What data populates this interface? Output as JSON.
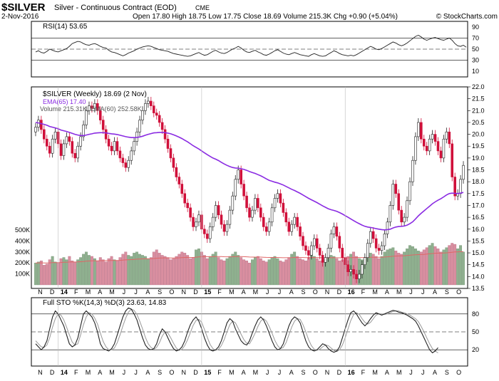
{
  "header": {
    "symbol": "$SILVER",
    "description": "Silver - Continuous Contract (EOD)",
    "exchange": "CME",
    "date": "2-Nov-2016",
    "quote_line": "Open 17.80  High 18.75  Low 17.75  Close 18.69  Volume 215.3K  Chg +0.90 (+5.04%)",
    "copyright": "© StockCharts.com"
  },
  "colors": {
    "up": "#222222",
    "down": "#d0103a",
    "ema": "#8a2be2",
    "volume_up": "#8fb08f",
    "volume_down": "#d98fa0",
    "volume_ema": "#e06666",
    "indicator": "#222222",
    "signal": "#999999"
  },
  "x_ticks": [
    "N",
    "D",
    "14",
    "F",
    "M",
    "A",
    "M",
    "J",
    "J",
    "A",
    "S",
    "O",
    "N",
    "D",
    "15",
    "F",
    "M",
    "A",
    "M",
    "J",
    "J",
    "A",
    "S",
    "O",
    "N",
    "D",
    "16",
    "F",
    "M",
    "A",
    "M",
    "J",
    "J",
    "A",
    "S",
    "O"
  ],
  "rsi": {
    "legend": "RSI(14) 53.65",
    "ticks": [
      "90",
      "70",
      "50",
      "30",
      "10"
    ],
    "bands": [
      70,
      30
    ],
    "midline": 50
  },
  "price": {
    "legend_main": "$SILVER (Weekly) 18.69 (2 Nov)",
    "legend_ema": "EMA(65) 17.40",
    "legend_volume": "Volume 215.31K, EMA(60) 252.58K",
    "ticks": [
      "22.0",
      "21.5",
      "21.0",
      "20.5",
      "20.0",
      "19.5",
      "19.0",
      "18.5",
      "18.0",
      "17.5",
      "17.0",
      "16.5",
      "16.0",
      "15.5",
      "15.0",
      "14.5",
      "14.0",
      "13.5"
    ],
    "volume_ticks": [
      "500K",
      "400K",
      "300K",
      "200K",
      "100K"
    ]
  },
  "sto": {
    "legend": "Full STO %K(14,3) %D(3) 23.63, 14.83",
    "ticks": [
      "80",
      "50",
      "20"
    ],
    "bands": [
      80,
      20
    ],
    "midline": 50
  },
  "chart_data": {
    "type": "candlestick",
    "title": "$SILVER Silver - Continuous Contract (EOD) CME",
    "period": "Weekly",
    "ylim": [
      13.5,
      22.0
    ],
    "last_close": 18.69,
    "ema65_last": 17.4,
    "closes": [
      20.3,
      20.6,
      20.2,
      19.8,
      19.5,
      19.2,
      19.8,
      20.1,
      19.6,
      19.1,
      19.6,
      19.9,
      19.7,
      19.2,
      19.0,
      19.5,
      19.9,
      20.4,
      21.0,
      21.2,
      21.1,
      21.3,
      21.0,
      20.6,
      20.2,
      19.8,
      19.5,
      19.3,
      19.7,
      19.3,
      19.0,
      18.8,
      18.6,
      18.9,
      19.3,
      19.7,
      20.1,
      20.6,
      21.0,
      21.3,
      21.4,
      21.2,
      20.9,
      20.8,
      20.5,
      20.2,
      19.8,
      19.4,
      19.0,
      18.6,
      18.2,
      17.9,
      17.5,
      17.1,
      16.9,
      16.5,
      16.1,
      16.3,
      16.6,
      16.0,
      15.8,
      15.6,
      16.1,
      16.5,
      17.0,
      16.6,
      16.2,
      15.9,
      16.2,
      16.8,
      17.4,
      18.1,
      18.5,
      17.9,
      17.4,
      16.9,
      16.5,
      16.8,
      17.3,
      16.9,
      16.5,
      16.1,
      15.9,
      16.3,
      16.9,
      17.3,
      17.5,
      17.1,
      16.7,
      16.3,
      15.9,
      16.2,
      16.5,
      16.1,
      15.7,
      15.3,
      15.1,
      14.9,
      15.3,
      15.6,
      15.2,
      14.9,
      14.6,
      14.8,
      15.2,
      15.8,
      16.1,
      15.7,
      15.2,
      14.8,
      14.5,
      14.2,
      14.3,
      14.1,
      13.9,
      14.1,
      14.5,
      14.8,
      15.4,
      15.9,
      15.6,
      15.2,
      15.1,
      15.3,
      15.8,
      16.3,
      17.0,
      17.9,
      17.5,
      16.8,
      16.3,
      16.5,
      17.2,
      18.0,
      18.9,
      19.9,
      20.5,
      19.8,
      19.5,
      19.3,
      19.8,
      20.0,
      19.7,
      19.3,
      19.0,
      19.8,
      20.1,
      19.6,
      18.2,
      17.4,
      17.5,
      18.1,
      18.69
    ],
    "ema65": [
      20.5,
      20.48,
      20.45,
      20.42,
      20.38,
      20.33,
      20.3,
      20.27,
      20.23,
      20.18,
      20.15,
      20.12,
      20.08,
      20.04,
      20.0,
      19.97,
      19.95,
      19.95,
      19.97,
      20.0,
      20.02,
      20.05,
      20.06,
      20.07,
      20.07,
      20.06,
      20.04,
      20.02,
      20.01,
      19.99,
      19.96,
      19.93,
      19.9,
      19.88,
      19.86,
      19.86,
      19.87,
      19.89,
      19.92,
      19.96,
      20.0,
      20.03,
      20.06,
      20.07,
      20.08,
      20.08,
      20.07,
      20.05,
      20.02,
      19.98,
      19.93,
      19.88,
      19.82,
      19.75,
      19.68,
      19.6,
      19.52,
      19.45,
      19.38,
      19.3,
      19.22,
      19.14,
      19.07,
      19.0,
      18.95,
      18.89,
      18.82,
      18.75,
      18.69,
      18.64,
      18.6,
      18.58,
      18.57,
      18.55,
      18.52,
      18.48,
      18.43,
      18.39,
      18.35,
      18.3,
      18.25,
      18.19,
      18.12,
      18.06,
      18.02,
      17.98,
      17.95,
      17.91,
      17.86,
      17.8,
      17.74,
      17.68,
      17.63,
      17.57,
      17.51,
      17.44,
      17.37,
      17.3,
      17.24,
      17.18,
      17.12,
      17.05,
      16.98,
      16.92,
      16.86,
      16.82,
      16.79,
      16.75,
      16.7,
      16.64,
      16.57,
      16.5,
      16.43,
      16.36,
      16.29,
      16.23,
      16.17,
      16.12,
      16.09,
      16.07,
      16.05,
      16.02,
      16.0,
      15.98,
      15.97,
      15.98,
      16.0,
      16.05,
      16.09,
      16.11,
      16.12,
      16.13,
      16.17,
      16.23,
      16.31,
      16.43,
      16.56,
      16.67,
      16.77,
      16.87,
      16.97,
      17.07,
      17.15,
      17.22,
      17.28,
      17.36,
      17.44,
      17.5,
      17.52,
      17.51,
      17.5,
      17.52,
      17.55
    ],
    "volume_k": [
      200,
      210,
      220,
      180,
      190,
      230,
      260,
      210,
      200,
      240,
      250,
      230,
      260,
      220,
      210,
      230,
      250,
      280,
      300,
      270,
      260,
      240,
      220,
      250,
      230,
      210,
      240,
      260,
      230,
      220,
      250,
      280,
      300,
      270,
      260,
      290,
      300,
      280,
      270,
      260,
      240,
      250,
      300,
      320,
      290,
      270,
      260,
      250,
      230,
      240,
      260,
      280,
      300,
      290,
      270,
      240,
      250,
      320,
      330,
      300,
      270,
      240,
      260,
      280,
      300,
      250,
      230,
      220,
      240,
      260,
      280,
      300,
      270,
      250,
      230,
      220,
      200,
      230,
      250,
      260,
      240,
      220,
      210,
      230,
      250,
      260,
      240,
      220,
      210,
      230,
      250,
      280,
      300,
      260,
      240,
      230,
      220,
      250,
      280,
      260,
      240,
      220,
      210,
      230,
      250,
      270,
      260,
      240,
      220,
      230,
      250,
      260,
      280,
      300,
      260,
      240,
      230,
      250,
      270,
      290,
      280,
      260,
      240,
      260,
      300,
      320,
      330,
      340,
      310,
      290,
      280,
      300,
      330,
      360,
      350,
      330,
      310,
      300,
      320,
      340,
      360,
      380,
      350,
      330,
      300,
      320,
      340,
      360,
      380,
      370,
      330,
      360,
      300
    ],
    "rsi_values": [
      45,
      47,
      44,
      43,
      46,
      50,
      48,
      46,
      45,
      47,
      49,
      51,
      55,
      60,
      62,
      64,
      63,
      60,
      58,
      57,
      59,
      60,
      58,
      55,
      53,
      52,
      48,
      45,
      44,
      42,
      40,
      38,
      40,
      43,
      45,
      47,
      50,
      52,
      54,
      55,
      56,
      55,
      53,
      51,
      49,
      48,
      47,
      46,
      44,
      42,
      41,
      40,
      39,
      38,
      37,
      38,
      40,
      42,
      44,
      41,
      39,
      40,
      43,
      46,
      48,
      45,
      43,
      42,
      44,
      47,
      50,
      52,
      55,
      52,
      48,
      45,
      44,
      46,
      48,
      45,
      43,
      40,
      39,
      41,
      44,
      47,
      49,
      46,
      43,
      41,
      40,
      42,
      44,
      42,
      40,
      39,
      38,
      37,
      40,
      42,
      40,
      38,
      37,
      38,
      41,
      44,
      47,
      45,
      42,
      40,
      39,
      38,
      39,
      38,
      40,
      43,
      46,
      49,
      52,
      55,
      53,
      50,
      49,
      51,
      54,
      57,
      60,
      63,
      61,
      58,
      56,
      58,
      61,
      65,
      69,
      73,
      75,
      72,
      68,
      66,
      68,
      70,
      71,
      69,
      67,
      66,
      68,
      70,
      66,
      60,
      56,
      55,
      57,
      53.65
    ],
    "sto_k": [
      30,
      25,
      20,
      25,
      35,
      55,
      75,
      85,
      80,
      70,
      60,
      45,
      30,
      25,
      28,
      40,
      60,
      80,
      85,
      80,
      75,
      65,
      50,
      30,
      22,
      20,
      18,
      22,
      30,
      45,
      60,
      75,
      85,
      90,
      88,
      80,
      70,
      55,
      40,
      28,
      22,
      20,
      22,
      30,
      45,
      55,
      50,
      40,
      30,
      22,
      18,
      20,
      25,
      35,
      50,
      62,
      70,
      75,
      68,
      55,
      40,
      28,
      20,
      18,
      20,
      25,
      35,
      50,
      65,
      72,
      68,
      55,
      45,
      35,
      30,
      28,
      35,
      48,
      60,
      70,
      75,
      70,
      60,
      48,
      35,
      25,
      20,
      22,
      30,
      45,
      60,
      70,
      75,
      72,
      65,
      50,
      35,
      25,
      20,
      18,
      20,
      25,
      30,
      28,
      22,
      18,
      16,
      18,
      25,
      40,
      55,
      70,
      82,
      85,
      80,
      72,
      65,
      60,
      65,
      72,
      78,
      82,
      80,
      78,
      80,
      82,
      84,
      86,
      85,
      83,
      82,
      80,
      78,
      75,
      72,
      68,
      60,
      50,
      40,
      30,
      20,
      15,
      18,
      23.63
    ],
    "sto_d": [
      35,
      30,
      25,
      24,
      28,
      40,
      58,
      72,
      80,
      78,
      70,
      58,
      45,
      33,
      28,
      30,
      45,
      62,
      75,
      82,
      80,
      73,
      63,
      48,
      34,
      25,
      20,
      20,
      23,
      32,
      45,
      60,
      73,
      83,
      88,
      86,
      79,
      68,
      55,
      41,
      30,
      24,
      21,
      24,
      32,
      43,
      50,
      48,
      40,
      31,
      23,
      19,
      21,
      27,
      37,
      49,
      61,
      69,
      71,
      66,
      54,
      41,
      29,
      22,
      19,
      21,
      27,
      37,
      50,
      62,
      68,
      65,
      56,
      46,
      37,
      31,
      30,
      38,
      48,
      59,
      68,
      72,
      68,
      59,
      48,
      36,
      27,
      22,
      24,
      32,
      45,
      58,
      68,
      72,
      71,
      62,
      50,
      37,
      27,
      21,
      19,
      21,
      25,
      28,
      27,
      23,
      19,
      17,
      20,
      28,
      40,
      55,
      69,
      79,
      82,
      79,
      72,
      66,
      63,
      66,
      72,
      78,
      80,
      80,
      79,
      80,
      82,
      84,
      85,
      85,
      83,
      82,
      80,
      78,
      75,
      72,
      67,
      59,
      50,
      40,
      30,
      22,
      18,
      14.83
    ],
    "ticks_x": [
      "N",
      "D",
      "14",
      "F",
      "M",
      "A",
      "M",
      "J",
      "J",
      "A",
      "S",
      "O",
      "N",
      "D",
      "15",
      "F",
      "M",
      "A",
      "M",
      "J",
      "J",
      "A",
      "S",
      "O",
      "N",
      "D",
      "16",
      "F",
      "M",
      "A",
      "M",
      "J",
      "J",
      "A",
      "S",
      "O"
    ]
  }
}
